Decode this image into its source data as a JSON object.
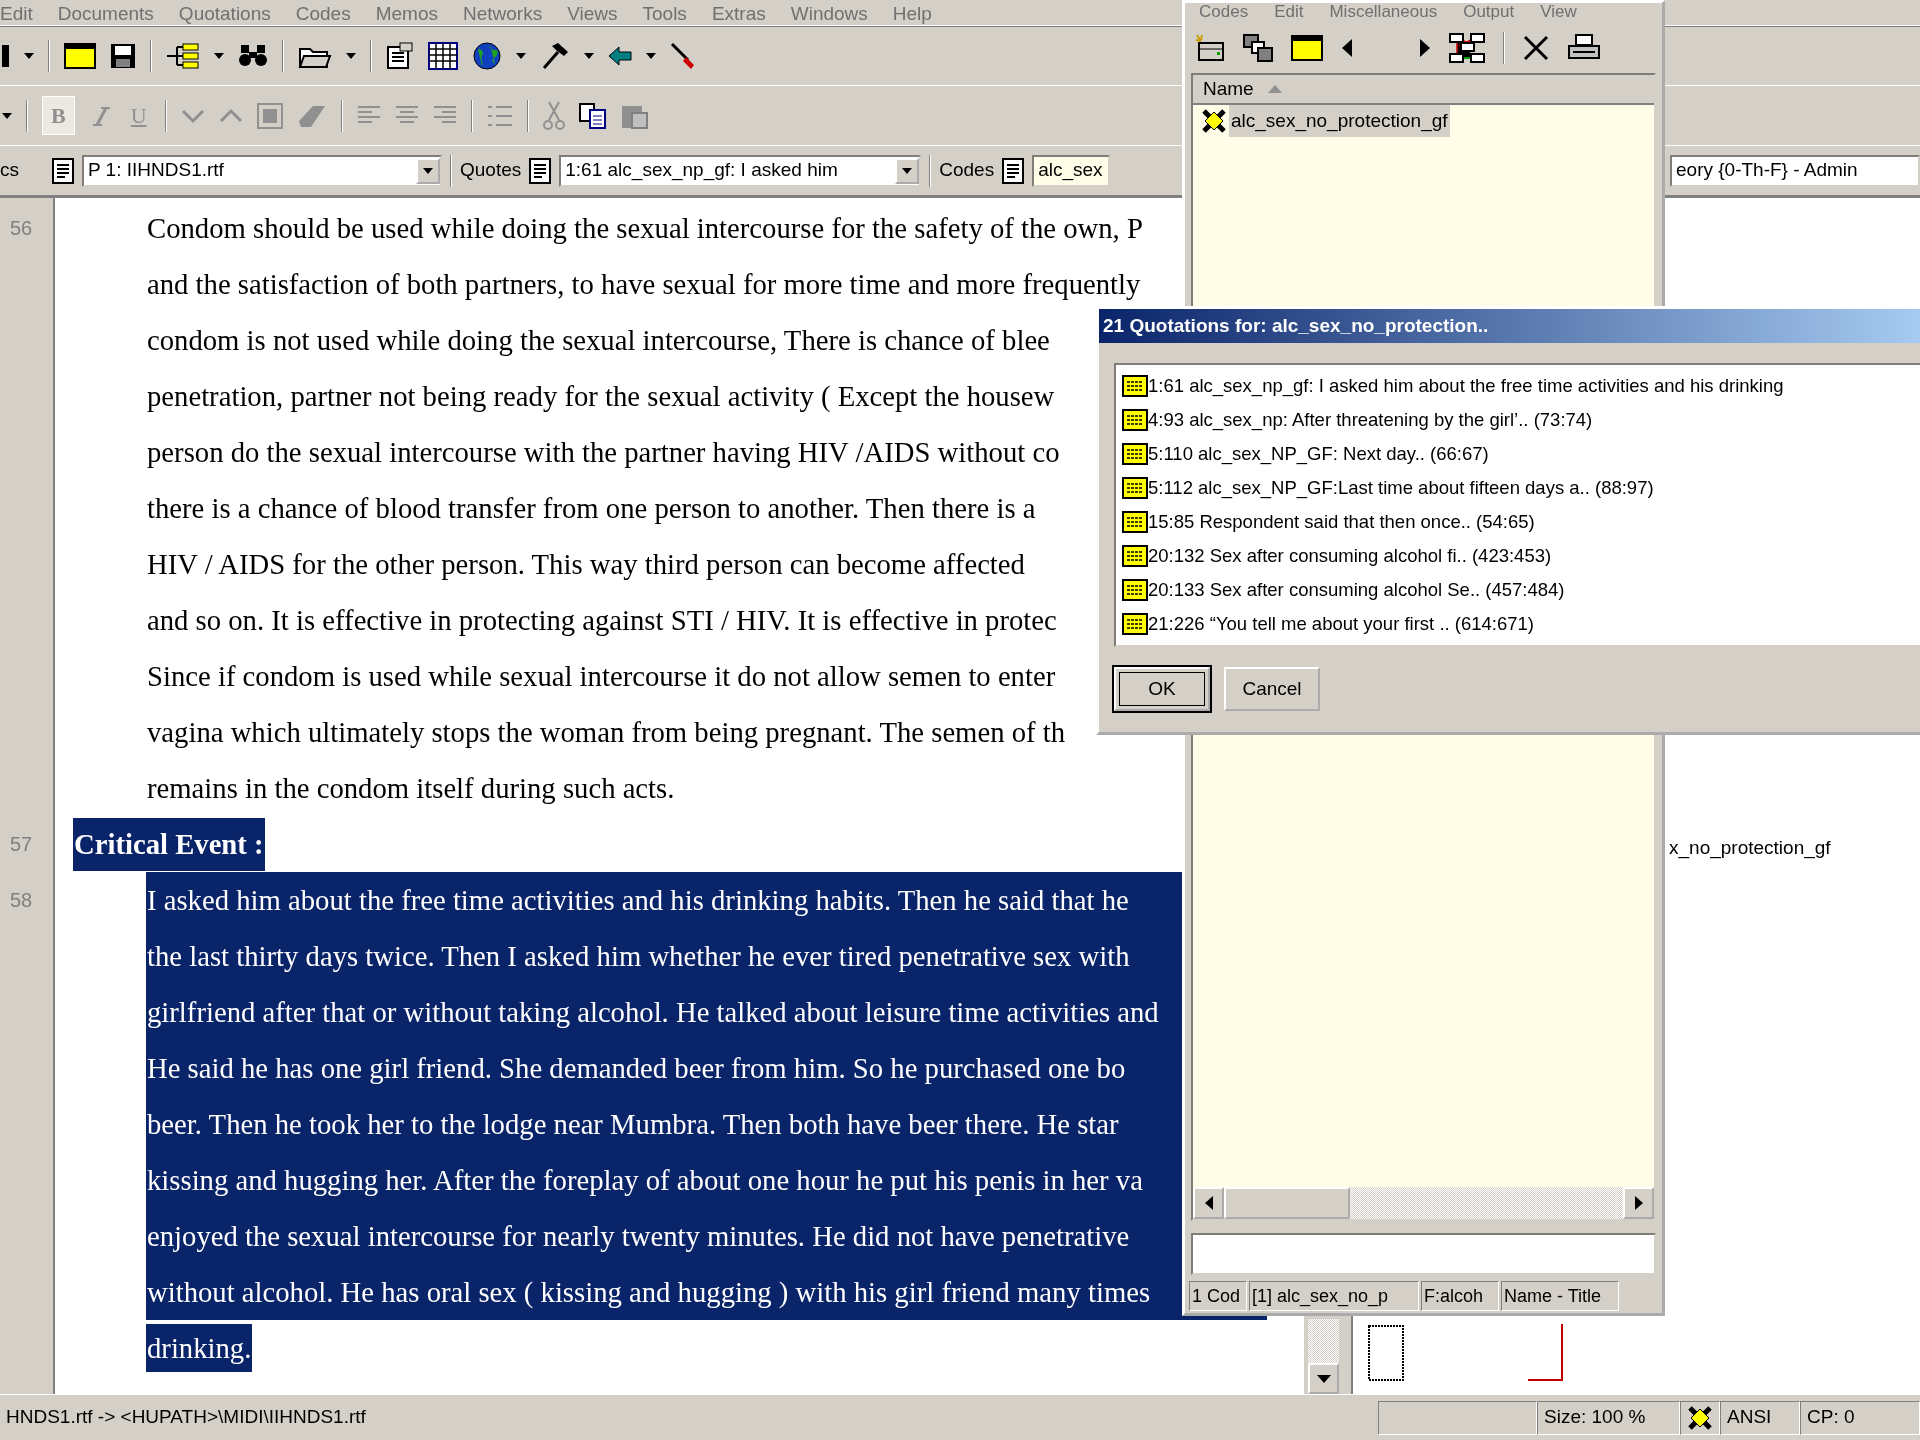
{
  "main_window": {
    "menu": [
      "Edit",
      "Documents",
      "Quotations",
      "Codes",
      "Memos",
      "Networks",
      "Views",
      "Tools",
      "Extras",
      "Windows",
      "Help"
    ],
    "format_toolbar": {
      "bold": "B",
      "underline": "U"
    },
    "selectors": {
      "documents_label": "cs",
      "document": "P 1: IIHNDS1.rtf",
      "quotes_label": "Quotes",
      "quote": "1:61 alc_sex_np_gf: I asked him",
      "codes_label": "Codes",
      "code": "alc_sex",
      "title_field": "eory {0-Th-F} - Admin"
    },
    "document": {
      "paragraphs": [
        {
          "number": "56",
          "kind": "body",
          "selected": false,
          "lines": [
            "Condom should be used while doing the sexual intercourse for the safety of the own, P",
            "and the satisfaction of both partners, to have sexual for more time and more frequently",
            "condom is not used while doing the sexual intercourse, There is chance of blee",
            "penetration, partner not being ready for the sexual activity ( Except the housew",
            "person do the sexual intercourse with the partner having HIV /AIDS without co",
            "there is a chance of blood transfer from one person to another. Then there is a",
            "HIV / AIDS for the other person. This way third person can become affected",
            "and so on. It is effective in protecting against STI / HIV. It is effective in protec",
            "Since if condom is used while sexual intercourse it do not allow semen to enter",
            "vagina which ultimately stops the woman from being pregnant. The semen of th",
            "remains in the condom itself during such acts."
          ]
        },
        {
          "number": "57",
          "kind": "heading",
          "selected": true,
          "lines": [
            "Critical Event :"
          ]
        },
        {
          "number": "58",
          "kind": "body",
          "selected": true,
          "lines": [
            "I asked him about the free time activities and his drinking habits. Then he said that he",
            "the last thirty days twice. Then I asked him whether he ever tired penetrative sex with",
            "girlfriend after that or without taking alcohol. He talked about leisure time activities and",
            "He said he has one girl friend. She demanded beer from him. So he purchased one bo",
            "beer. Then he took her to the lodge near Mumbra. Then both have beer there. He star",
            "kissing and hugging her. After the foreplay of about one hour he put his penis in her va",
            "enjoyed the sexual intercourse for nearly twenty minutes. He did not have penetrative",
            "without alcohol. He has oral sex ( kissing and hugging ) with his girl friend many times",
            "drinking."
          ]
        }
      ]
    },
    "margin": {
      "code_label": "x_no_protection_gf"
    },
    "status_bar": {
      "path": "HNDS1.rtf -> <HUPATH>\\MIDI\\IIHNDS1.rtf",
      "size": "Size: 100 %",
      "encoding": "ANSI",
      "code_page": "CP: 0"
    }
  },
  "code_manager": {
    "menu": [
      "Codes",
      "Edit",
      "Miscellaneous",
      "Output",
      "View"
    ],
    "column": "Name",
    "codes": [
      {
        "name": "alc_sex_no_protection_gf",
        "selected": true
      }
    ],
    "status": [
      "1 Cod",
      "[1] alc_sex_no_p",
      "F:alcoh",
      "Name - Title"
    ]
  },
  "dialog": {
    "title": "21 Quotations for: alc_sex_no_protection..",
    "quotations": [
      "1:61 alc_sex_np_gf: I asked him about the free time activities and his drinking",
      "4:93 alc_sex_np: After threatening by the girl’.. (73:74)",
      "5:110 alc_sex_NP_GF: Next day.. (66:67)",
      "5:112 alc_sex_NP_GF:Last time about fifteen days a.. (88:97)",
      "15:85 Respondent said that then once.. (54:65)",
      "20:132 Sex after consuming alcohol fi.. (423:453)",
      "20:133 Sex after consuming alcohol Se.. (457:484)",
      "21:226 “You tell me about your first .. (614:671)"
    ],
    "buttons": [
      {
        "label": "OK",
        "default": true
      },
      {
        "label": "Cancel",
        "default": false
      }
    ]
  }
}
